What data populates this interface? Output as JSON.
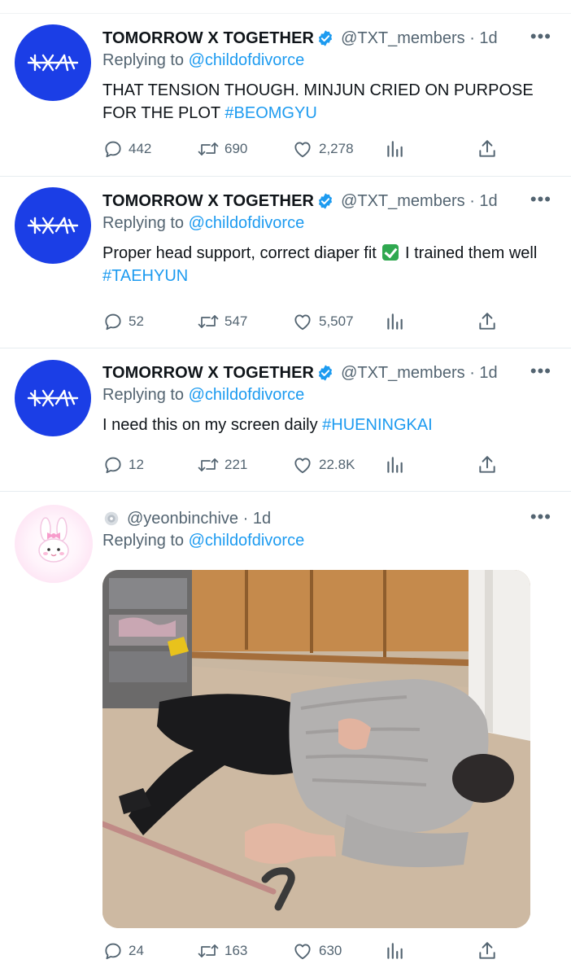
{
  "tweets": [
    {
      "name": "TOMORROW X TOGETHER",
      "handle": "@TXT_members",
      "time": "1d",
      "replying_label": "Replying to",
      "replying_to": "@childofdivorce",
      "text": "THAT TENSION THOUGH. MINJUN CRIED ON PURPOSE FOR THE PLOT",
      "hashtag": "#BEOMGYU",
      "replies": "442",
      "retweets": "690",
      "likes": "2,278"
    },
    {
      "name": "TOMORROW X TOGETHER",
      "handle": "@TXT_members",
      "time": "1d",
      "replying_label": "Replying to",
      "replying_to": "@childofdivorce",
      "text_before": "Proper head support, correct diaper fit",
      "text_after": "I trained them well",
      "hashtag": "#TAEHYUN",
      "replies": "52",
      "retweets": "547",
      "likes": "5,507"
    },
    {
      "name": "TOMORROW X TOGETHER",
      "handle": "@TXT_members",
      "time": "1d",
      "replying_label": "Replying to",
      "replying_to": "@childofdivorce",
      "text": "I need this on my screen daily",
      "hashtag": "#HUENINGKAI",
      "replies": "12",
      "retweets": "221",
      "likes": "22.8K"
    },
    {
      "handle": "@yeonbinchive",
      "time": "1d",
      "replying_label": "Replying to",
      "replying_to": "@childofdivorce",
      "replies": "24",
      "retweets": "163",
      "likes": "630"
    }
  ],
  "sep": "·",
  "icons": {
    "more": "more-horizontal-icon",
    "verified": "verified-badge-icon",
    "reply": "reply-icon",
    "retweet": "retweet-icon",
    "like": "heart-icon",
    "views": "views-icon",
    "share": "share-icon"
  },
  "colors": {
    "link": "#1d9bf0",
    "secondary_text": "#536471",
    "avatar_blue": "#1b3ee6"
  }
}
